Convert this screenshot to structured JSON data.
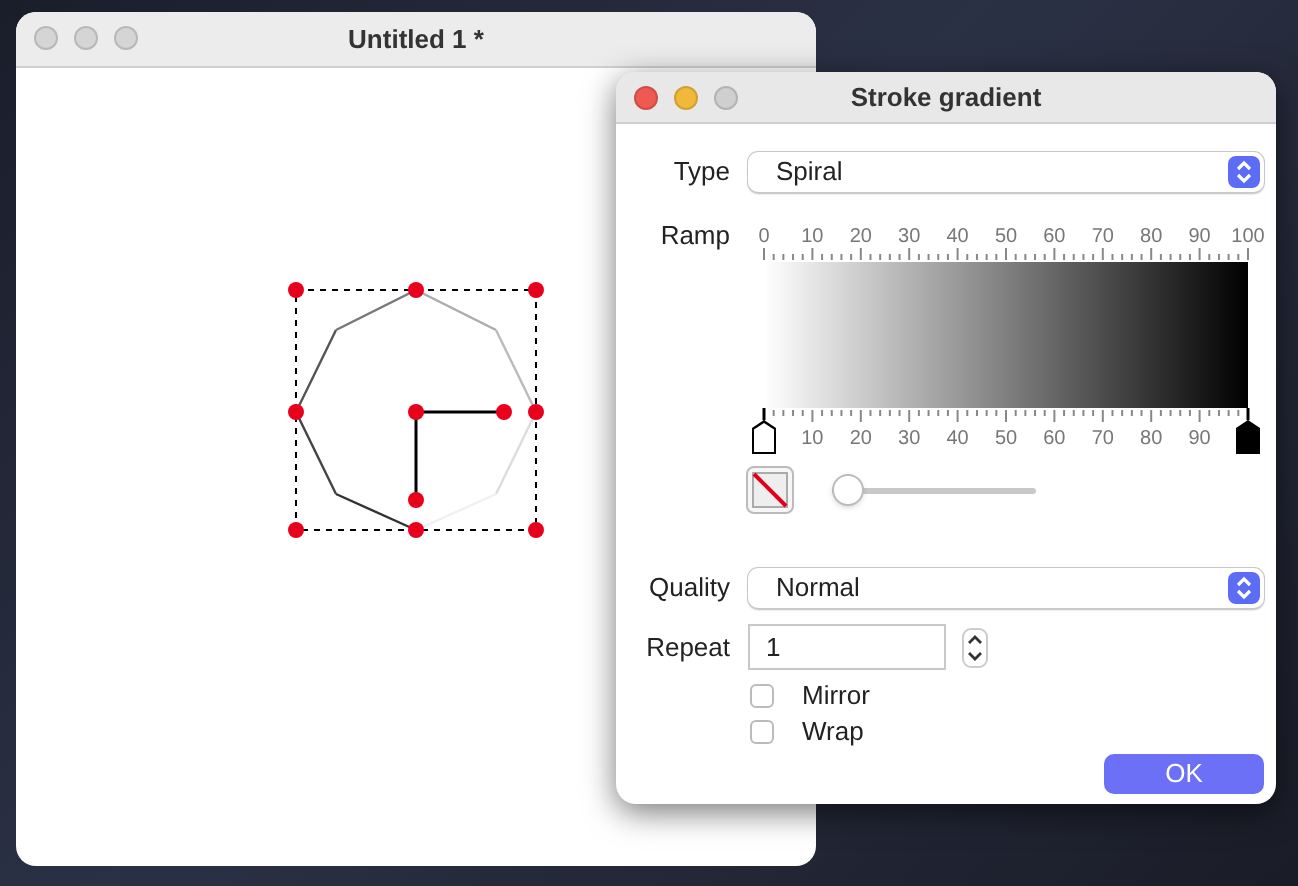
{
  "main_window": {
    "title": "Untitled 1 *"
  },
  "dialog": {
    "title": "Stroke gradient",
    "type": {
      "label": "Type",
      "value": "Spiral"
    },
    "ramp": {
      "label": "Ramp",
      "top_ticks": [
        "0",
        "10",
        "20",
        "30",
        "40",
        "50",
        "60",
        "70",
        "80",
        "90",
        "100"
      ],
      "bottom_ticks": [
        "10",
        "20",
        "30",
        "40",
        "50",
        "60",
        "70",
        "80",
        "90"
      ],
      "stops": [
        {
          "color": "#ffffff"
        },
        {
          "color": "#000000"
        }
      ],
      "opacity": {
        "level": 0.08
      }
    },
    "quality": {
      "label": "Quality",
      "value": "Normal"
    },
    "repeat": {
      "label": "Repeat",
      "value": "1"
    },
    "options": [
      {
        "label": "Mirror",
        "checked": false
      },
      {
        "label": "Wrap",
        "checked": false
      }
    ],
    "ok_button": "OK"
  }
}
